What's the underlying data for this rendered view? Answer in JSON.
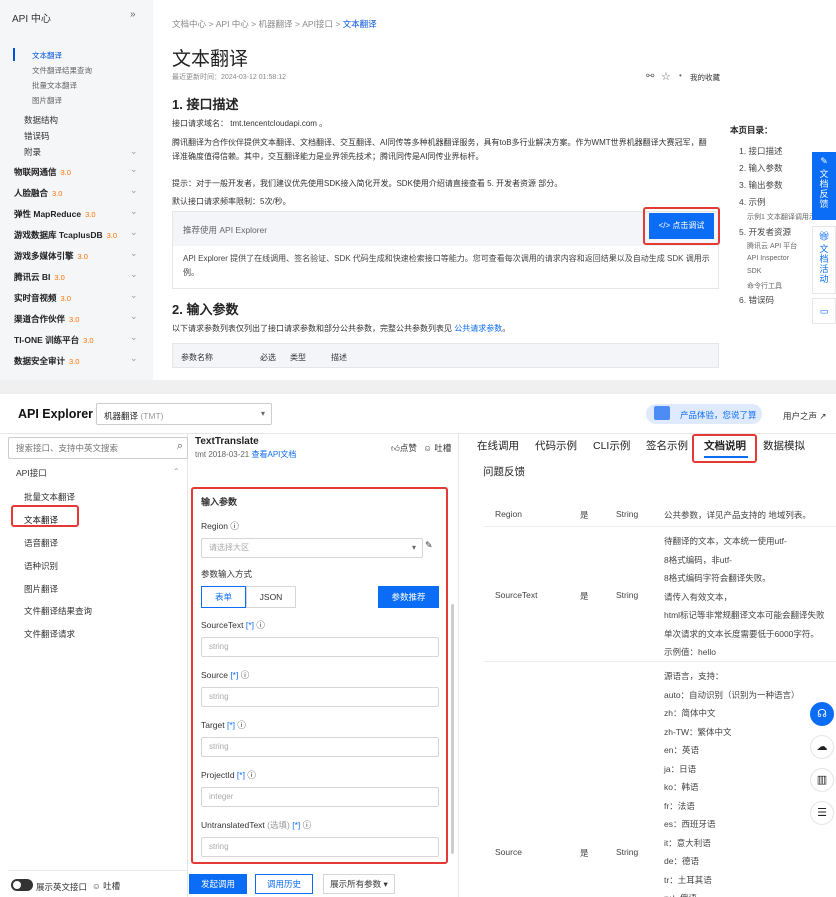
{
  "top": {
    "nav": {
      "header": "API 中心",
      "collapse_icon": "double-chevron-icon",
      "items": [
        "文本翻译",
        "文件翻译结果查询",
        "批量文本翻译",
        "图片翻译"
      ],
      "subs": [
        "数据结构",
        "错误码",
        "附录"
      ],
      "categories": [
        {
          "name": "物联网通信",
          "ver": "3.0"
        },
        {
          "name": "人脸融合",
          "ver": "3.0"
        },
        {
          "name": "弹性 MapReduce",
          "ver": "3.0"
        },
        {
          "name": "游戏数据库 TcaplusDB",
          "ver": "3.0"
        },
        {
          "name": "游戏多媒体引擎",
          "ver": "3.0"
        },
        {
          "name": "腾讯云 BI",
          "ver": "3.0"
        },
        {
          "name": "实时音视频",
          "ver": "3.0"
        },
        {
          "name": "渠道合作伙伴",
          "ver": "3.0"
        },
        {
          "name": "TI-ONE 训练平台",
          "ver": "3.0"
        },
        {
          "name": "数据安全审计",
          "ver": "3.0"
        }
      ]
    },
    "breadcrumb": {
      "parts": [
        "文档中心",
        "API 中心",
        "机器翻译",
        "API接口"
      ],
      "sep": ">",
      "current": "文本翻译"
    },
    "title": "文本翻译",
    "updated": "最近更新时间：2024-03-12 01:58:12",
    "fav": "我的收藏",
    "sec1": "1. 接口描述",
    "domain_line": "接口请求域名： tmt.tencentcloudapi.com 。",
    "desc1": "腾讯翻译为合作伙伴提供文本翻译、文档翻译、交互翻译、AI同传等多种机器翻译服务，具有toB多行业解决方案。作为WMT世界机器翻译大赛冠军，翻",
    "desc2": "译准确度值得信赖。其中，交互翻译能力是业界领先技术；腾讯同传是AI同传业界标杆。",
    "tip": "提示：对于一般开发者，我们建议优先使用SDK接入简化开发。SDK使用介绍请直接查看 5. 开发者资源 部分。",
    "rate": "默认接口请求频率限制：5次/秒。",
    "explorer_title": "推荐使用 API Explorer",
    "debug_btn": "</>  点击调试",
    "explorer_text": "API Explorer 提供了在线调用、签名验证、SDK 代码生成和快速检索接口等能力。您可查看每次调用的请求内容和返回结果以及自动生成 SDK 调用示例。",
    "sec2": "2. 输入参数",
    "params_intro": "以下请求参数列表仅列出了接口请求参数和部分公共参数，完整公共参数列表见",
    "params_link": "公共请求参数",
    "table_heads": [
      "参数名称",
      "必选",
      "类型",
      "描述"
    ],
    "toc_title": "本页目录：",
    "toc": [
      {
        "t": "1. 接口描述",
        "sub": false
      },
      {
        "t": "2. 输入参数",
        "sub": false
      },
      {
        "t": "3. 输出参数",
        "sub": false
      },
      {
        "t": "4. 示例",
        "sub": false
      },
      {
        "t": "示例1 文本翻译调用示例",
        "sub": true
      },
      {
        "t": "5. 开发者资源",
        "sub": false
      },
      {
        "t": "腾讯云 API 平台",
        "sub": true
      },
      {
        "t": "API Inspector",
        "sub": true
      },
      {
        "t": "SDK",
        "sub": true
      },
      {
        "t": "命令行工具",
        "sub": true
      },
      {
        "t": "6. 错误码",
        "sub": false
      }
    ],
    "float_blue": "文档反馈",
    "float_white": "文档活动"
  },
  "bottom": {
    "app_title": "API Explorer",
    "service": "机器翻译",
    "service_sub": "(TMT)",
    "promo": "产品体验，您说了算",
    "voice": "用户之声",
    "search_placeholder": "搜索接口、支持中英文搜索",
    "api_group": "API接口",
    "api_items": [
      "批量文本翻译",
      "文本翻译",
      "语音翻译",
      "语种识别",
      "图片翻译",
      "文件翻译结果查询",
      "文件翻译请求"
    ],
    "show_en": "展示英文接口",
    "complain": "吐槽",
    "api_name": "TextTranslate",
    "api_date": "tmt 2018-03-21",
    "api_doc_link": "查看API文档",
    "like": "点赞",
    "complain2": "吐槽",
    "form_title": "输入参数",
    "region_label": "Region",
    "region_placeholder": "请选择大区",
    "input_mode_label": "参数输入方式",
    "mode_form": "表单",
    "mode_json": "JSON",
    "rec_btn": "参数推荐",
    "fields": [
      {
        "name": "SourceText",
        "req": "[*]",
        "placeholder": "string"
      },
      {
        "name": "Source",
        "req": "[*]",
        "placeholder": "string"
      },
      {
        "name": "Target",
        "req": "[*]",
        "placeholder": "string"
      },
      {
        "name": "ProjectId",
        "req": "[*]",
        "placeholder": "integer"
      },
      {
        "name": "UntranslatedText",
        "opt": "(选填)",
        "req": "[*]",
        "placeholder": "string"
      }
    ],
    "call_btn": "发起调用",
    "hist_btn": "调用历史",
    "show_all": "展示所有参数",
    "tabs": [
      "在线调用",
      "代码示例",
      "CLI示例",
      "签名示例",
      "文档说明",
      "数据模拟",
      "问题反馈"
    ],
    "rows": [
      {
        "name": "Region",
        "req": "是",
        "type": "String",
        "lines": [
          "公共参数，详见产品支持的 地域列表。"
        ]
      },
      {
        "name": "SourceText",
        "req": "是",
        "type": "String",
        "lines": [
          "待翻译的文本，文本统一使用utf-",
          "8格式编码，非utf-",
          "8格式编码字符会翻译失败。",
          "请传入有效文本，",
          "html标记等非常规翻译文本可能会翻译失败",
          "单次请求的文本长度需要低于6000字符。",
          "示例值：hello"
        ]
      },
      {
        "name": "Source",
        "req": "是",
        "type": "String",
        "lines": [
          "源语言，支持：",
          "auto：自动识别（识别为一种语言）",
          "zh：简体中文",
          "zh-TW：繁体中文",
          "en：英语",
          "ja：日语",
          "ko：韩语",
          "fr：法语",
          "es：西班牙语",
          "it：意大利语",
          "de：德语",
          "tr：土耳其语",
          "ru：俄语"
        ]
      }
    ]
  }
}
